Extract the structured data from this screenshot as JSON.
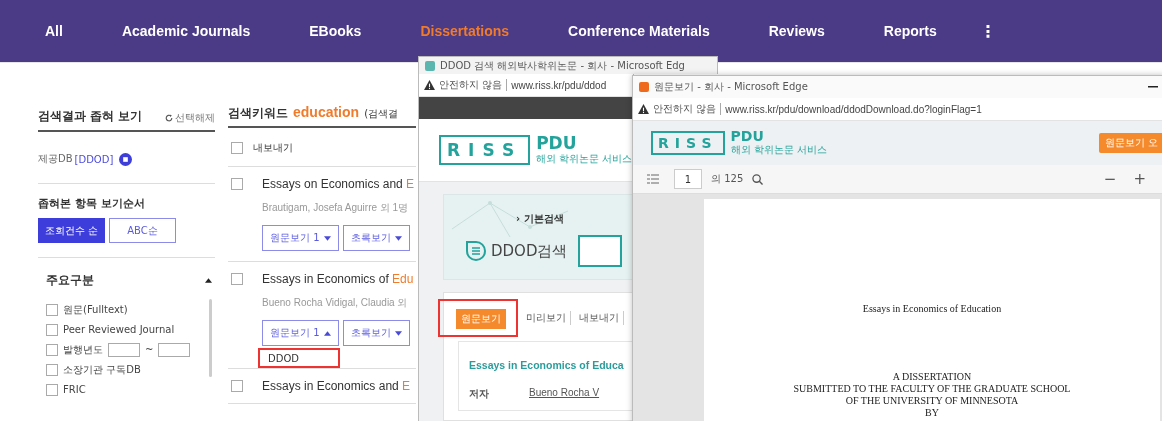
{
  "nav": {
    "tabs": [
      {
        "label": "All",
        "selected": false
      },
      {
        "label": "Academic Journals",
        "selected": false
      },
      {
        "label": "EBooks",
        "selected": false
      },
      {
        "label": "Dissertations",
        "selected": true
      },
      {
        "label": "Conference Materials",
        "selected": false
      },
      {
        "label": "Reviews",
        "selected": false
      },
      {
        "label": "Reports",
        "selected": false
      }
    ],
    "more": "⋮"
  },
  "filter_panel": {
    "title": "검색결과 좁혀 보기",
    "reset": "선택해제",
    "applied_filter": {
      "label": "제공DB",
      "value": "[DDOD]"
    },
    "sort_title": "좁혀본 항목 보기순서",
    "sort_options": [
      {
        "label": "조회건수 순",
        "selected": true
      },
      {
        "label": "ABC순",
        "selected": false
      }
    ],
    "section": {
      "title": "주요구분",
      "expanded": true,
      "options": [
        {
          "kind": "checkbox",
          "label": "원문(Fulltext)",
          "checked": false
        },
        {
          "kind": "checkbox",
          "label": "Peer Reviewed Journal",
          "checked": false
        },
        {
          "kind": "year_range",
          "label": "발행년도",
          "separator": "~",
          "checked": false
        },
        {
          "kind": "checkbox",
          "label": "소장기관 구독DB",
          "checked": false
        },
        {
          "kind": "checkbox",
          "label": "FRIC",
          "checked": false
        }
      ]
    }
  },
  "results": {
    "heading": "검색키워드",
    "keyword": "education",
    "note": "(검색결",
    "export": "내보내기",
    "export_checked": false,
    "items": [
      {
        "checked": false,
        "title": "Essays on Economics and ",
        "title_highlight": "E",
        "authors": "Brautigam, Josefa Aguirre 외 1명",
        "fulltext_button": "원문보기 1",
        "abstract_button": "초록보기",
        "dropdown_open": false
      },
      {
        "checked": false,
        "title": "Essays in Economics of ",
        "title_highlight": "Edu",
        "authors": "Bueno Rocha Vidigal, Claudia 외",
        "fulltext_button": "원문보기 1",
        "abstract_button": "초록보기",
        "dropdown_open": true,
        "dropdown_items": [
          {
            "label": "DDOD",
            "highlighted": true
          }
        ]
      },
      {
        "checked": false,
        "title": "Essays in Economics and ",
        "title_highlight": "E"
      }
    ]
  },
  "window_1": {
    "title": "DDOD 검색 해외박사학위논문 - 회사 - Microsoft Edg",
    "security": "안전하지 않음",
    "url": "www.riss.kr/pdu/ddod",
    "logo": {
      "text": "RISS",
      "product": "PDU",
      "tagline": "해외 학위논문 서비스"
    },
    "search_tab": "› 기본검색",
    "search_title": "DDOD검색",
    "actions": [
      {
        "kind": "primary",
        "label": "원문보기",
        "highlighted": true
      },
      {
        "kind": "link",
        "label": "미리보기",
        "highlighted": false
      },
      {
        "kind": "link",
        "label": "내보내기",
        "highlighted": false
      }
    ],
    "record": {
      "title": "Essays in Economics of Educa",
      "fields": [
        {
          "label": "저자",
          "value": "Bueno Rocha V"
        }
      ]
    }
  },
  "window_2": {
    "title": "원문보기 - 회사 - Microsoft Edge",
    "security": "안전하지 않음",
    "url": "www.riss.kr/pdu/download/ddodDownload.do?loginFlag=1",
    "logo": {
      "text": "RISS",
      "product": "PDU",
      "tagline": "해외 학위논문 서비스"
    },
    "header_button": "원문보기 오",
    "page": "1",
    "page_total": "의 125",
    "zoom_out": "−",
    "zoom_in": "+",
    "document": {
      "title": "Essays in Economics of Education",
      "lines": [
        "A DISSERTATION",
        "SUBMITTED TO THE FACULTY OF THE GRADUATE SCHOOL",
        "OF THE UNIVERSITY OF MINNESOTA",
        "BY"
      ]
    }
  }
}
